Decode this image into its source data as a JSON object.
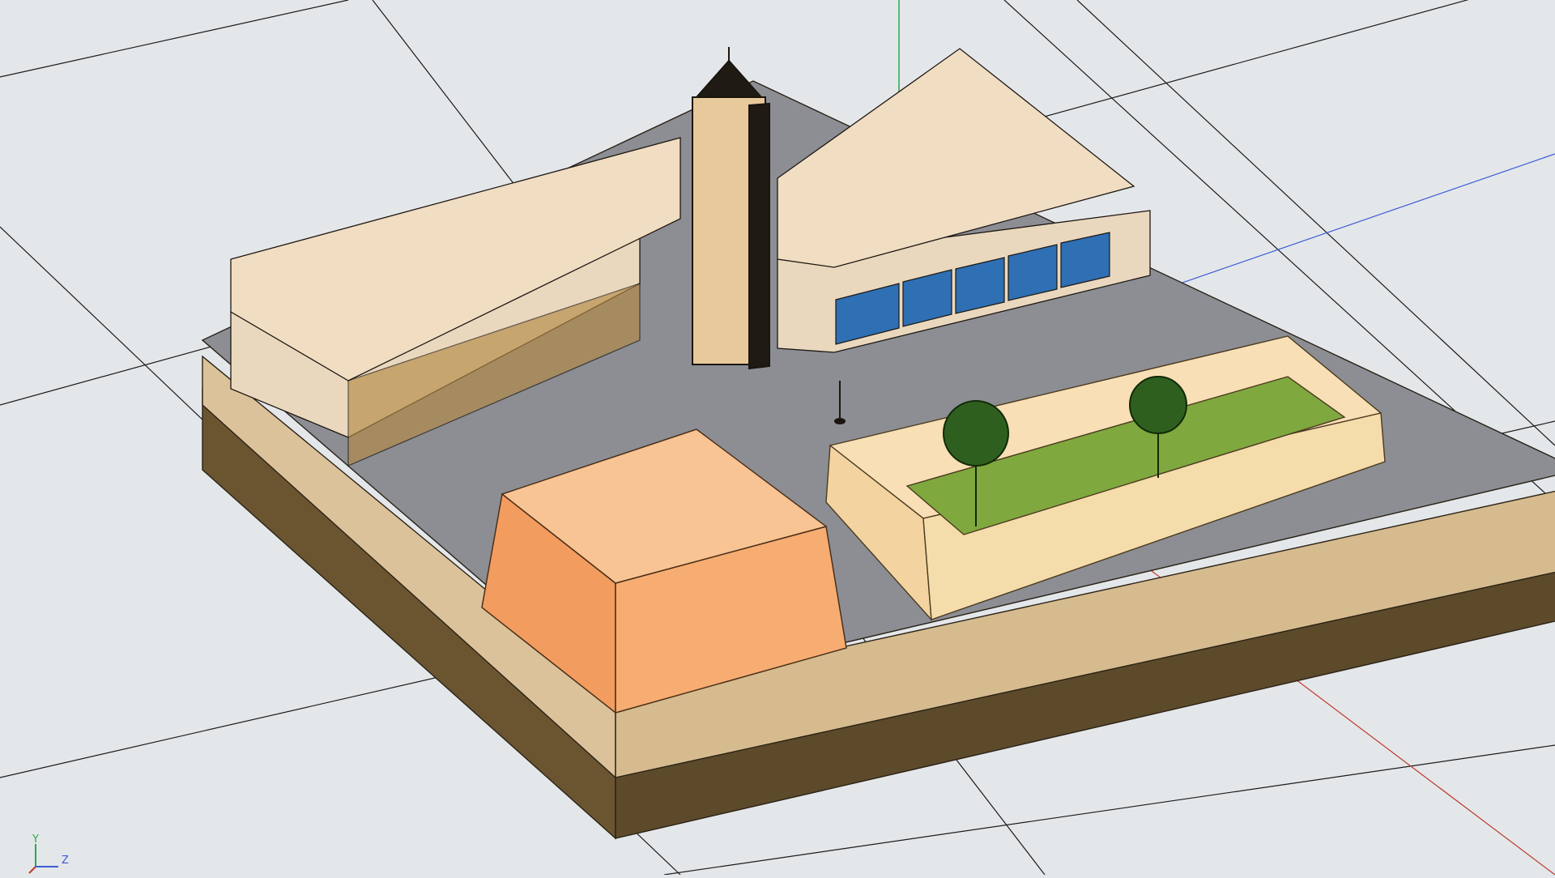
{
  "viewport": {
    "background": "#e4e7ea",
    "grid_color": "#1a1a1a",
    "axis_colors": {
      "x": "#c0392b",
      "y": "#2aa84a",
      "z": "#3b5bd6"
    }
  },
  "gizmo": {
    "y_label": "Y",
    "z_label": "Z"
  },
  "model": {
    "palette": {
      "plaza": "#8c8e94",
      "base_top": "#dcc29a",
      "base_bottom": "#6b5531",
      "building": "#f1ddc2",
      "dome_building": "#f7ad72",
      "garden_wall": "#f8dfb5",
      "lawn": "#7fa83f",
      "glass": "#2f6fb4",
      "tower": "#e8c99b"
    }
  }
}
